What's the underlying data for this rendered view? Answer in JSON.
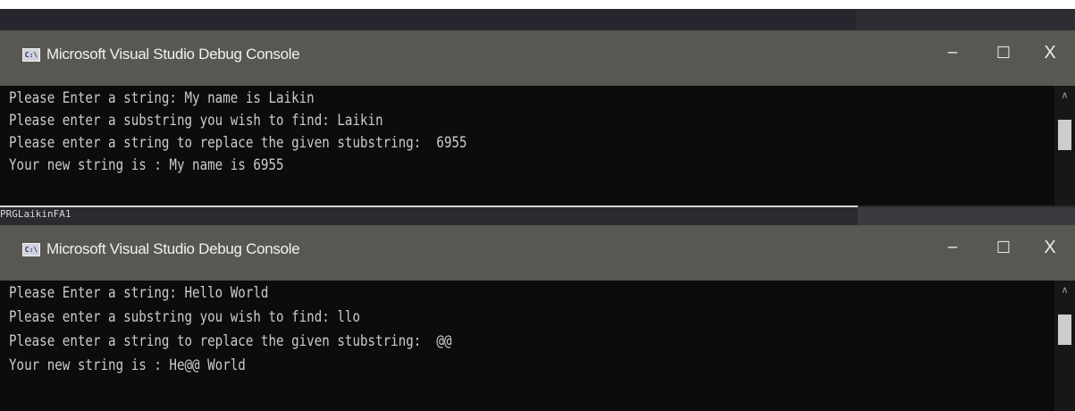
{
  "windows": [
    {
      "title": "Microsoft Visual Studio Debug Console",
      "icon_text": "C:\\",
      "controls": {
        "minimize": "–",
        "maximize": "☐",
        "close": "X"
      },
      "lines": [
        "Please Enter a string: My name is Laikin",
        "Please enter a substring you wish to find: Laikin",
        "Please enter a string to replace the given stubstring:  6955",
        "Your new string is : My name is 6955"
      ]
    },
    {
      "title": "Microsoft Visual Studio Debug Console",
      "icon_text": "C:\\",
      "controls": {
        "minimize": "–",
        "maximize": "☐",
        "close": "X"
      },
      "lines": [
        "Please Enter a string: Hello World",
        "Please enter a substring you wish to find: llo",
        "Please enter a string to replace the given stubstring:  @@",
        "Your new string is : He@@ World"
      ]
    }
  ],
  "background_label": "PRGLaikinFA1",
  "colors": {
    "titlebar": "#585752",
    "console_bg": "#0c0c0c",
    "console_text": "#cccccc",
    "ide_bg": "#26262e"
  }
}
